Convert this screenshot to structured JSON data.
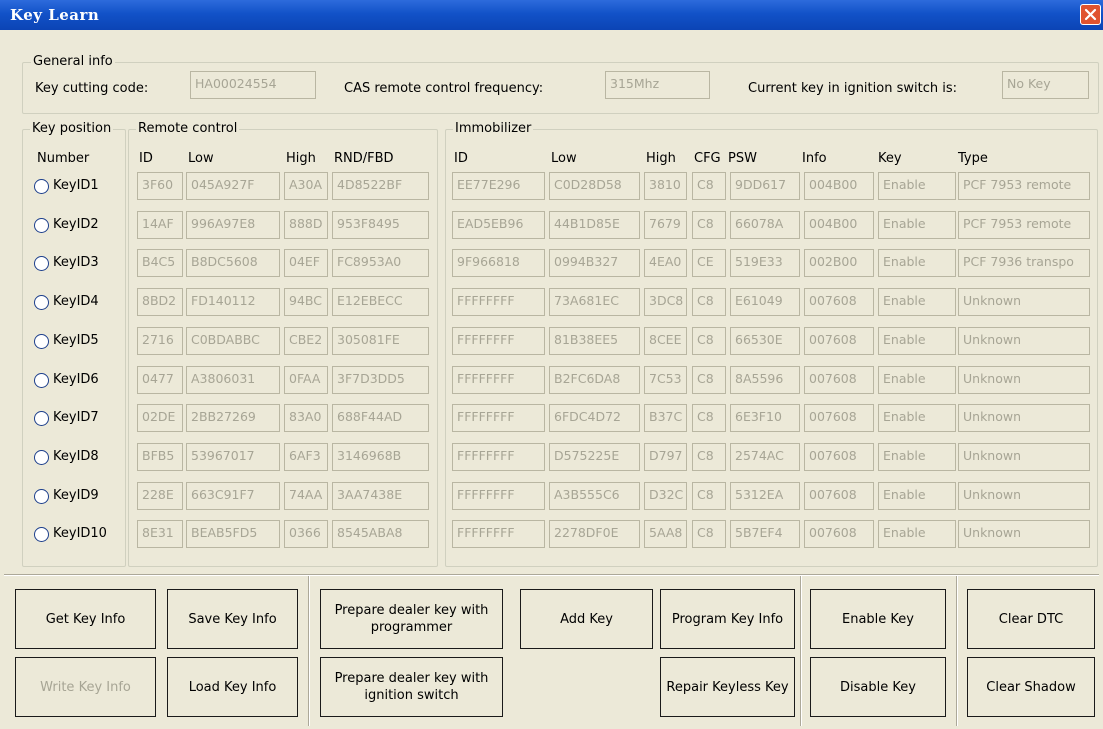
{
  "window": {
    "title": "Key Learn"
  },
  "general": {
    "legend": "General info",
    "cutting_label": "Key cutting code:",
    "cutting_value": "HA00024554",
    "freq_label": "CAS remote control frequency:",
    "freq_value": "315Mhz",
    "ign_label": "Current key in ignition switch is:",
    "ign_value": "No Key"
  },
  "keypos": {
    "legend": "Key position",
    "header": "Number",
    "items": [
      "KeyID1",
      "KeyID2",
      "KeyID3",
      "KeyID4",
      "KeyID5",
      "KeyID6",
      "KeyID7",
      "KeyID8",
      "KeyID9",
      "KeyID10"
    ]
  },
  "remote": {
    "legend": "Remote control",
    "headers": [
      "ID",
      "Low",
      "High",
      "RND/FBD"
    ],
    "rows": [
      [
        "3F60",
        "045A927F",
        "A30A",
        "4D8522BF"
      ],
      [
        "14AF",
        "996A97E8",
        "888D",
        "953F8495"
      ],
      [
        "B4C5",
        "B8DC5608",
        "04EF",
        "FC8953A0"
      ],
      [
        "8BD2",
        "FD140112",
        "94BC",
        "E12EBECC"
      ],
      [
        "2716",
        "C0BDABBC",
        "CBE2",
        "305081FE"
      ],
      [
        "0477",
        "A3806031",
        "0FAA",
        "3F7D3DD5"
      ],
      [
        "02DE",
        "2BB27269",
        "83A0",
        "688F44AD"
      ],
      [
        "BFB5",
        "53967017",
        "6AF3",
        "3146968B"
      ],
      [
        "228E",
        "663C91F7",
        "74AA",
        "3AA7438E"
      ],
      [
        "8E31",
        "BEAB5FD5",
        "0366",
        "8545ABA8"
      ]
    ]
  },
  "immo": {
    "legend": "Immobilizer",
    "headers": [
      "ID",
      "Low",
      "High",
      "CFG",
      "PSW",
      "Info",
      "Key",
      "Type"
    ],
    "rows": [
      [
        "EE77E296",
        "C0D28D58",
        "3810",
        "C8",
        "9DD617",
        "004B00",
        "Enable",
        "PCF 7953 remote"
      ],
      [
        "EAD5EB96",
        "44B1D85E",
        "7679",
        "C8",
        "66078A",
        "004B00",
        "Enable",
        "PCF 7953 remote"
      ],
      [
        "9F966818",
        "0994B327",
        "4EA0",
        "CE",
        "519E33",
        "002B00",
        "Enable",
        "PCF 7936 transpo"
      ],
      [
        "FFFFFFFF",
        "73A681EC",
        "3DC8",
        "C8",
        "E61049",
        "007608",
        "Enable",
        "Unknown"
      ],
      [
        "FFFFFFFF",
        "81B38EE5",
        "8CEE",
        "C8",
        "66530E",
        "007608",
        "Enable",
        "Unknown"
      ],
      [
        "FFFFFFFF",
        "B2FC6DA8",
        "7C53",
        "C8",
        "8A5596",
        "007608",
        "Enable",
        "Unknown"
      ],
      [
        "FFFFFFFF",
        "6FDC4D72",
        "B37C",
        "C8",
        "6E3F10",
        "007608",
        "Enable",
        "Unknown"
      ],
      [
        "FFFFFFFF",
        "D575225E",
        "D797",
        "C8",
        "2574AC",
        "007608",
        "Enable",
        "Unknown"
      ],
      [
        "FFFFFFFF",
        "A3B555C6",
        "D32C",
        "C8",
        "5312EA",
        "007608",
        "Enable",
        "Unknown"
      ],
      [
        "FFFFFFFF",
        "2278DF0E",
        "5AA8",
        "C8",
        "5B7EF4",
        "007608",
        "Enable",
        "Unknown"
      ]
    ]
  },
  "buttons": {
    "get_info": "Get Key Info",
    "save_info": "Save Key Info",
    "prep_programmer": "Prepare dealer key with programmer",
    "add_key": "Add Key",
    "program_info": "Program Key Info",
    "enable_key": "Enable Key",
    "clear_dtc": "Clear DTC",
    "write_info": "Write Key Info",
    "load_info": "Load Key Info",
    "prep_ignition": "Prepare dealer key with ignition switch",
    "repair_keyless": "Repair Keyless Key",
    "disable_key": "Disable Key",
    "clear_shadow": "Clear Shadow"
  }
}
